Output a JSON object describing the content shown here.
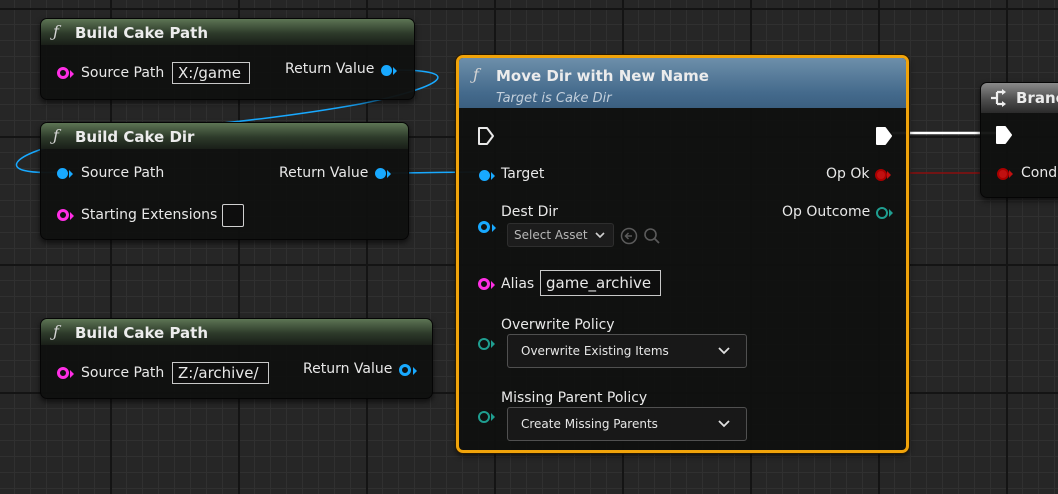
{
  "nodes": {
    "build_path_1": {
      "fn_glyph": "ƒ",
      "title": "Build Cake Path",
      "inputs": [
        {
          "label": "Source Path",
          "value": "X:/game"
        }
      ],
      "outputs": [
        {
          "label": "Return Value"
        }
      ]
    },
    "build_dir": {
      "fn_glyph": "ƒ",
      "title": "Build Cake Dir",
      "inputs": [
        {
          "label": "Source Path"
        },
        {
          "label": "Starting Extensions",
          "checked": false
        }
      ],
      "outputs": [
        {
          "label": "Return Value"
        }
      ]
    },
    "build_path_2": {
      "fn_glyph": "ƒ",
      "title": "Build Cake Path",
      "inputs": [
        {
          "label": "Source Path",
          "value": "Z:/archive/"
        }
      ],
      "outputs": [
        {
          "label": "Return Value"
        }
      ]
    },
    "move_dir": {
      "fn_glyph": "ƒ",
      "title": "Move Dir with New Name",
      "subtitle": "Target is Cake Dir",
      "inputs": [
        {
          "label": "Target"
        },
        {
          "label": "Dest Dir",
          "asset_placeholder": "Select Asset"
        },
        {
          "label": "Alias",
          "value": "game_archive"
        },
        {
          "label": "Overwrite Policy",
          "selected": "Overwrite Existing Items"
        },
        {
          "label": "Missing Parent Policy",
          "selected": "Create Missing Parents"
        }
      ],
      "outputs": [
        {
          "label": "Op Ok"
        },
        {
          "label": "Op Outcome"
        }
      ]
    },
    "branch": {
      "title": "Branch",
      "inputs": [
        {
          "label": "Condition"
        }
      ]
    }
  },
  "colors": {
    "selection": "#f0a30a",
    "exec_wire": "#ffffff",
    "object_wire": "#18a9ff",
    "string_pin": "#ff2ee5",
    "bool_pin": "#c01010",
    "enum_pin": "#1f9e90"
  },
  "icons": [
    "function-icon",
    "exec-pin-icon",
    "branch-icon",
    "chevron-down-icon",
    "back-arrow-icon",
    "search-icon"
  ]
}
